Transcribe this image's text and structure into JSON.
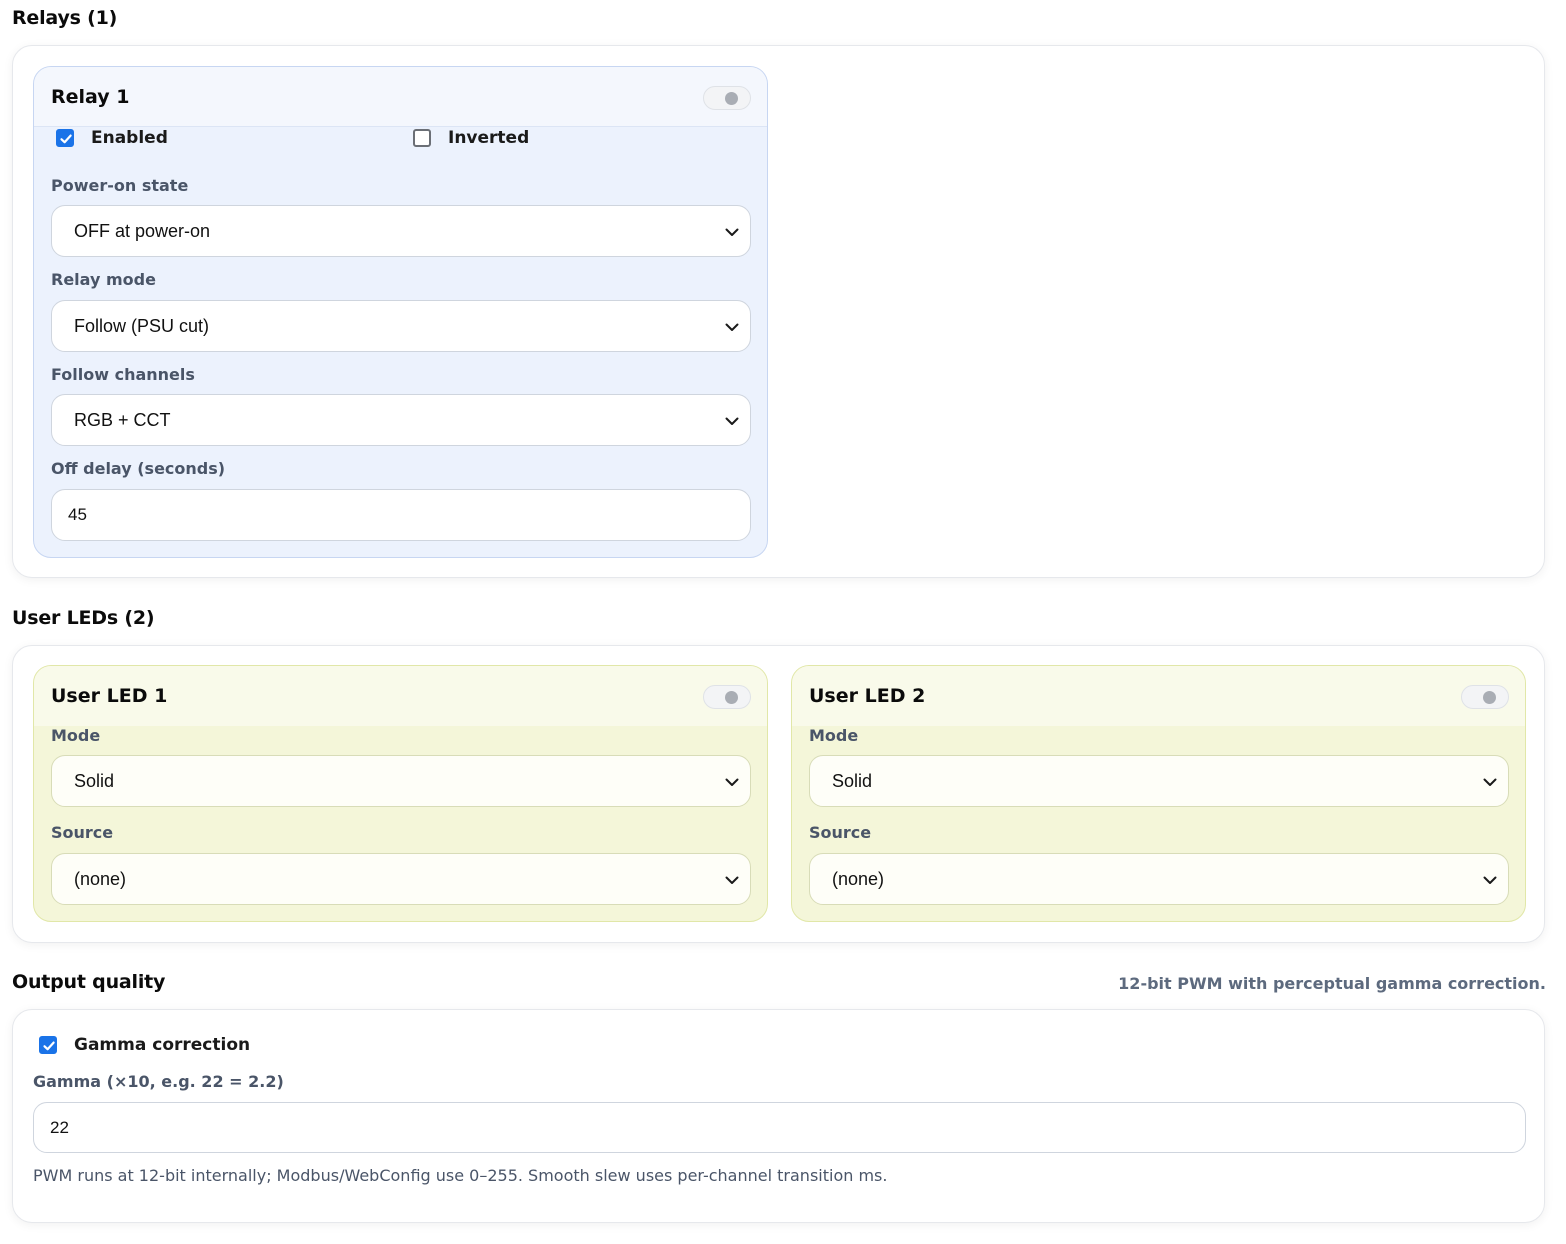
{
  "relays": {
    "title": "Relays (1)",
    "relay1": {
      "title": "Relay 1",
      "enabled_label": "Enabled",
      "inverted_label": "Inverted",
      "power_on_label": "Power-on state",
      "power_on_value": "OFF at power-on",
      "mode_label": "Relay mode",
      "mode_value": "Follow (PSU cut)",
      "follow_label": "Follow channels",
      "follow_value": "RGB + CCT",
      "off_delay_label": "Off delay (seconds)",
      "off_delay_value": "45"
    }
  },
  "user_leds": {
    "title": "User LEDs (2)",
    "led1": {
      "title": "User LED 1",
      "mode_label": "Mode",
      "mode_value": "Solid",
      "source_label": "Source",
      "source_value": "(none)"
    },
    "led2": {
      "title": "User LED 2",
      "mode_label": "Mode",
      "mode_value": "Solid",
      "source_label": "Source",
      "source_value": "(none)"
    }
  },
  "output_quality": {
    "title": "Output quality",
    "hint": "12-bit PWM with perceptual gamma correction.",
    "gamma_correction_label": "Gamma correction",
    "gamma_label": "Gamma (×10, e.g. 22 = 2.2)",
    "gamma_value": "22",
    "note": "PWM runs at 12-bit internally; Modbus/WebConfig use 0–255. Smooth slew uses per-channel transition ms."
  },
  "colors": {
    "accent": "#1a73e8",
    "relay_card_bg": "#ecf2fd",
    "led_card_bg": "#f4f6d9",
    "muted_text": "#4a5568"
  },
  "icons": {
    "select_arrow": "chevron-down-icon",
    "checkbox_checked": "checkmark-icon"
  }
}
